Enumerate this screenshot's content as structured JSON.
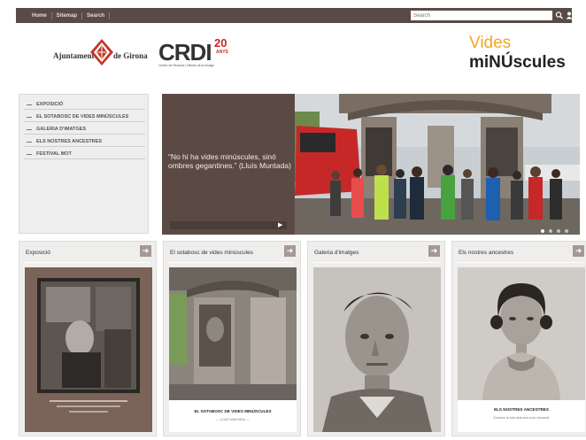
{
  "topbar": {
    "nav": [
      "Home",
      "Sitemap",
      "Search"
    ],
    "search_placeholder": "Search"
  },
  "header": {
    "ajuntament_left": "Ajuntament",
    "ajuntament_right": "de Girona",
    "crdi": "CRDI",
    "crdi_number": "20",
    "crdi_anys": "ANYS",
    "crdi_subtitle": "Centre de Recerca i Difusió de la Imatge",
    "vides": "Vides",
    "minuscules": "miNÚscules"
  },
  "sidebar": {
    "items": [
      "EXPOSICIÓ",
      "EL SOTABOSC DE VIDES MINÚSCULES",
      "GALERIA D'IMATGES",
      "ELS NOSTRES ANCESTRES",
      "FESTIVAL MOT"
    ]
  },
  "hero": {
    "quote": "“No hi ha vides minúscules, sinó ombres gegantines.” (Lluís Muntada)",
    "dots": 4
  },
  "cards": [
    {
      "title": "Exposició"
    },
    {
      "title": "El sotabosc de vides minúscules",
      "caption": "EL SOTABOSC DE VIDES MINÚSCULES",
      "subcaption": "— LLUÍS MUNTADA —"
    },
    {
      "title": "Galeria d'imatges"
    },
    {
      "title": "Els nostres ancestres",
      "caption": "ELS NOSTRES ANCESTRES",
      "subcaption": "Envia'ns la foto dels teus avis i besavis!"
    }
  ],
  "colors": {
    "topbar": "#5a4a45",
    "accent_orange": "#f5a623",
    "brand_red": "#c62828",
    "quote_panel": "#5b4a44",
    "card_bg": "#f0eeed"
  }
}
